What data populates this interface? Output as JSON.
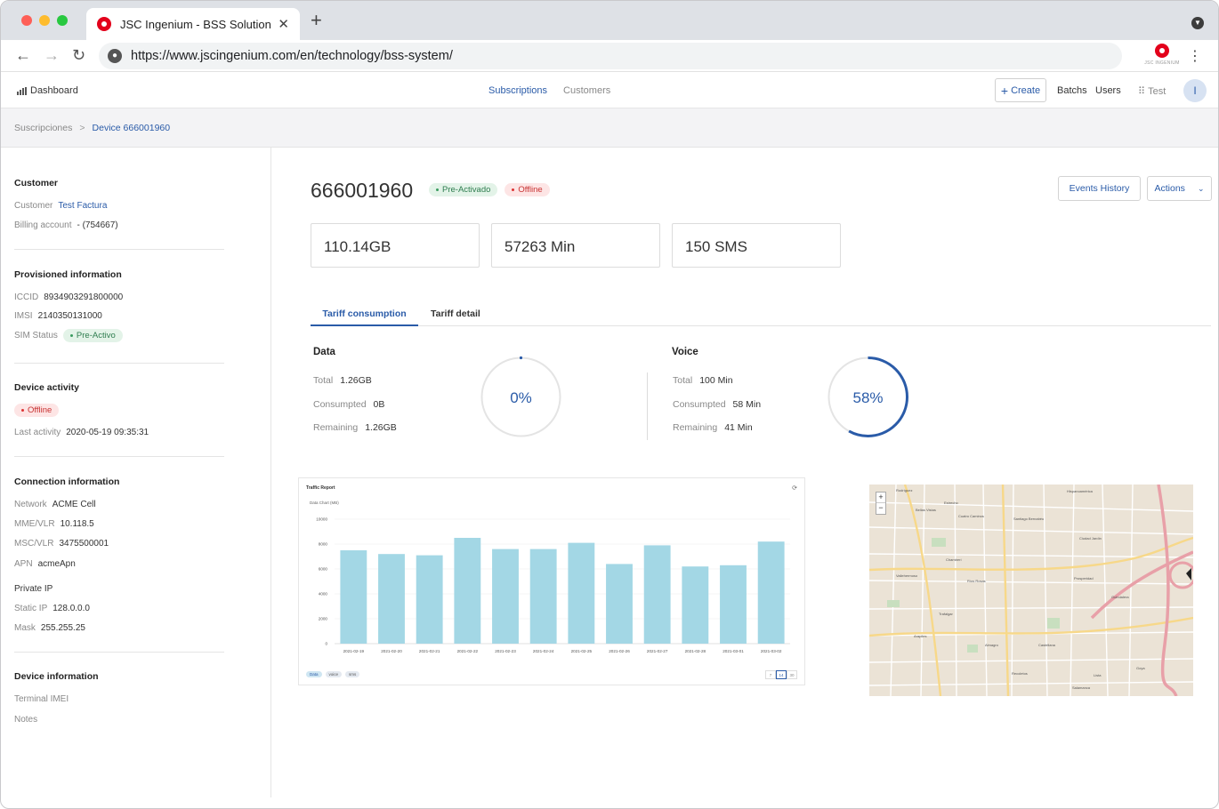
{
  "browser": {
    "tab_title": "JSC Ingenium - BSS Solution",
    "tab_close": "✕",
    "new_tab": "+",
    "url": "https://www.jscingenium.com/en/technology/bss-system/",
    "extension_label": "JSC INGENIUM"
  },
  "nav": {
    "dashboard": "Dashboard",
    "subscriptions": "Subscriptions",
    "customers": "Customers",
    "create": "Create",
    "batchs": "Batchs",
    "users": "Users",
    "test": "Test",
    "avatar_initial": "I"
  },
  "breadcrumb": {
    "parent": "Suscripciones",
    "separator": ">",
    "current": "Device 666001960"
  },
  "sidebar": {
    "customer": {
      "title": "Customer",
      "customer_label": "Customer",
      "customer_value": "Test Factura",
      "billing_label": "Billing account",
      "billing_value": "- (754667)"
    },
    "provisioned": {
      "title": "Provisioned information",
      "iccid_label": "ICCID",
      "iccid_value": "8934903291800000",
      "imsi_label": "IMSI",
      "imsi_value": "2140350131000",
      "sim_status_label": "SIM Status",
      "sim_status_value": "Pre-Activo"
    },
    "activity": {
      "title": "Device activity",
      "status": "Offline",
      "last_activity_label": "Last activity",
      "last_activity_value": "2020-05-19 09:35:31"
    },
    "connection": {
      "title": "Connection information",
      "network_label": "Network",
      "network_value": "ACME Cell",
      "mme_label": "MME/VLR",
      "mme_value": "10.118.5",
      "msc_label": "MSC/VLR",
      "msc_value": "3475500001",
      "apn_label": "APN",
      "apn_value": "acmeApn",
      "private_ip": "Private IP",
      "static_ip_label": "Static IP",
      "static_ip_value": "128.0.0.0",
      "mask_label": "Mask",
      "mask_value": "255.255.25"
    },
    "device": {
      "title": "Device information",
      "imei_label": "Terminal IMEI",
      "notes_label": "Notes"
    }
  },
  "main": {
    "device_number": "666001960",
    "badge_status": "Pre-Activado",
    "badge_online": "Offline",
    "events_history": "Events History",
    "actions": "Actions",
    "stats": [
      "110.14GB",
      "57263 Min",
      "150 SMS"
    ],
    "tabs": [
      "Tariff consumption",
      "Tariff detail"
    ],
    "data": {
      "title": "Data",
      "total_label": "Total",
      "total_value": "1.26GB",
      "consumpted_label": "Consumpted",
      "consumpted_value": "0B",
      "remaining_label": "Remaining",
      "remaining_value": "1.26GB",
      "percent": "0%",
      "percent_value": 0
    },
    "voice": {
      "title": "Voice",
      "total_label": "Total",
      "total_value": "100 Min",
      "consumpted_label": "Consumpted",
      "consumpted_value": "58 Min",
      "remaining_label": "Remaining",
      "remaining_value": "41 Min",
      "percent": "58%",
      "percent_value": 58
    }
  },
  "report": {
    "title": "Traffic Report",
    "refresh_icon": "⟳",
    "legend": [
      "Data",
      "voice",
      "sms"
    ],
    "range": [
      "7",
      "14",
      "30"
    ],
    "colors": {
      "bar": "#a3d7e5",
      "accent": "#2a5ba8"
    }
  },
  "chart_data": {
    "type": "bar",
    "title": "Traffic Report",
    "subtitle": "Data Chart (MB)",
    "categories": [
      "2021-02-19",
      "2021-02-20",
      "2021-02-21",
      "2021-02-22",
      "2021-02-23",
      "2021-02-24",
      "2021-02-25",
      "2021-02-26",
      "2021-02-27",
      "2021-02-28",
      "2021-03-01",
      "2021-03-02"
    ],
    "values": [
      7500,
      7200,
      7100,
      8500,
      7600,
      7600,
      8100,
      6400,
      7900,
      6200,
      6300,
      8200
    ],
    "yticks": [
      0,
      2000,
      4000,
      6000,
      8000,
      10000
    ],
    "ylim": [
      0,
      10000
    ],
    "xlabel": "",
    "ylabel": ""
  },
  "map": {
    "zoom_in": "+",
    "zoom_out": "−",
    "labels": [
      "Rodríguez",
      "Hispanoamérica",
      "Estrecho",
      "Bellas Vistas",
      "Cuatro Caminos",
      "Santiago Bernabéu",
      "Ciudad Jardín",
      "Vallehermoso",
      "Ríos Rosas",
      "Prosperidad",
      "Guindalera",
      "Arapiles",
      "Trafalgar",
      "Almagro",
      "Castellana",
      "Lista",
      "Salamanca",
      "Recoletos",
      "Goya",
      "Chamberí"
    ]
  }
}
